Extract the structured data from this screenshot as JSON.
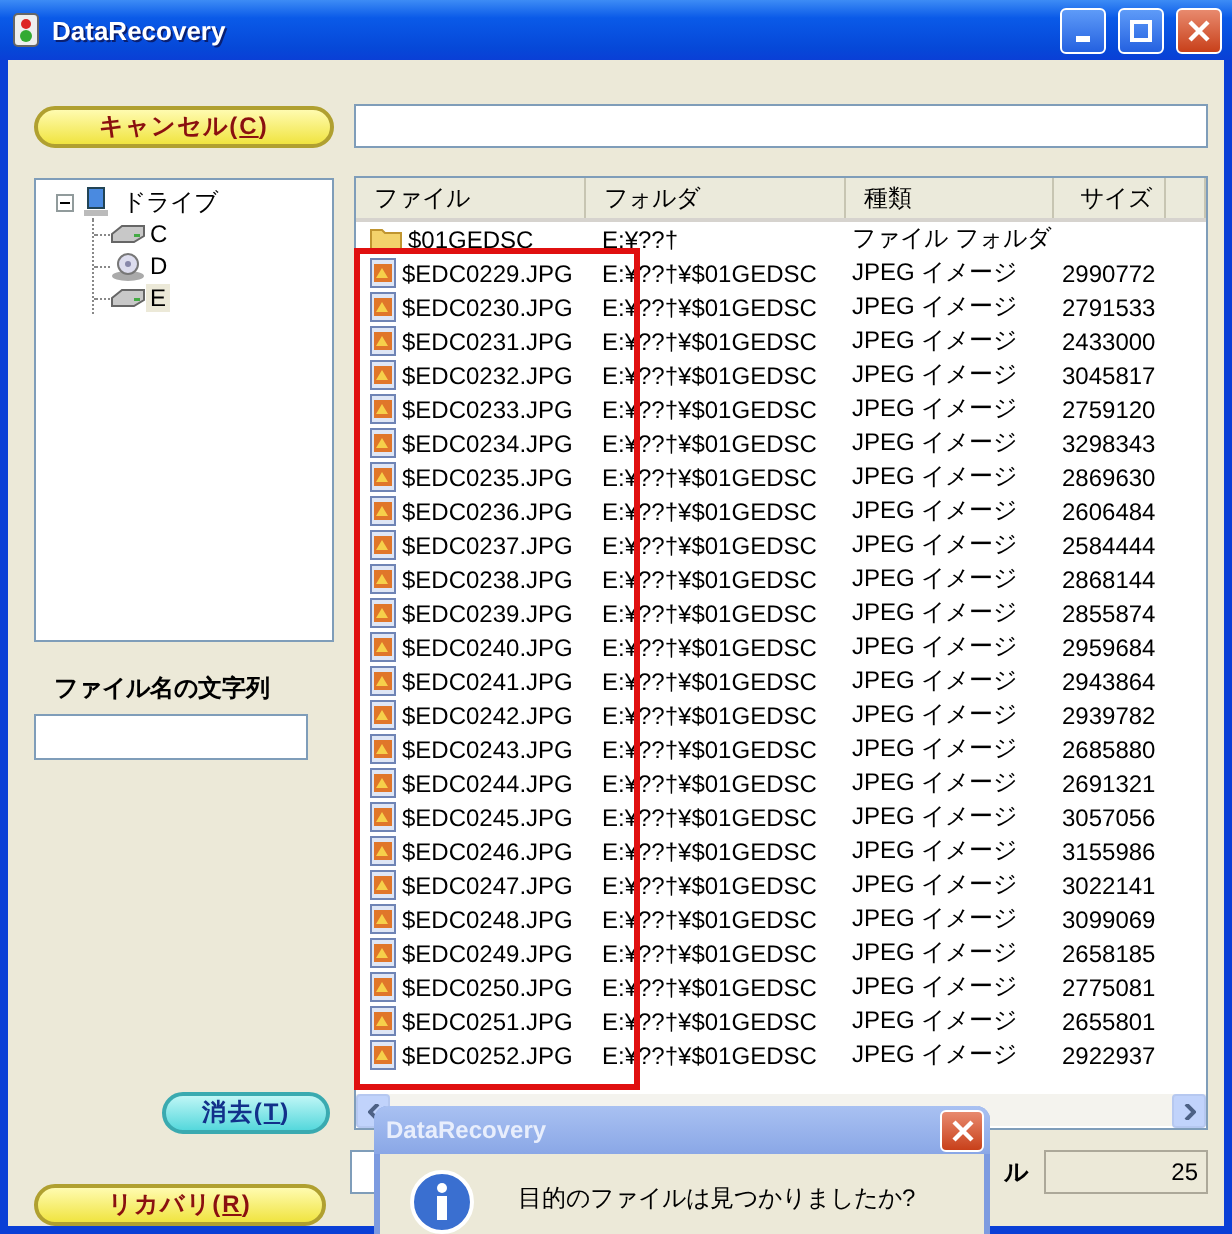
{
  "window": {
    "title": "DataRecovery"
  },
  "cancel_button": {
    "label_before": "キャンセル(",
    "mnemonic": "C",
    "label_after": ")"
  },
  "tree": {
    "label": "ドライブ",
    "expanded": true,
    "children": [
      {
        "label": "C",
        "kind": "hdd",
        "selected": false
      },
      {
        "label": "D",
        "kind": "cd",
        "selected": false
      },
      {
        "label": "E",
        "kind": "hdd",
        "selected": true
      }
    ]
  },
  "filename_filter": {
    "label": "ファイル名の文字列"
  },
  "clear_button": {
    "label_before": "消去(",
    "mnemonic": "T",
    "label_after": ")"
  },
  "recover_button": {
    "label_before": "リカバリ(",
    "mnemonic": "R",
    "label_after": ")"
  },
  "table": {
    "columns": [
      "ファイル",
      "フォルダ",
      "種類",
      "サイズ"
    ],
    "rows": [
      {
        "kind": "folder",
        "file": "$01GEDSC",
        "folder": "E:¥??†",
        "type": "ファイル フォルダ"
      },
      {
        "kind": "jpeg",
        "file": "$EDC0229.JPG",
        "folder": "E:¥??†¥$01GEDSC",
        "type": "JPEG イメージ",
        "size": "2990772"
      },
      {
        "kind": "jpeg",
        "file": "$EDC0230.JPG",
        "folder": "E:¥??†¥$01GEDSC",
        "type": "JPEG イメージ",
        "size": "2791533"
      },
      {
        "kind": "jpeg",
        "file": "$EDC0231.JPG",
        "folder": "E:¥??†¥$01GEDSC",
        "type": "JPEG イメージ",
        "size": "2433000"
      },
      {
        "kind": "jpeg",
        "file": "$EDC0232.JPG",
        "folder": "E:¥??†¥$01GEDSC",
        "type": "JPEG イメージ",
        "size": "3045817"
      },
      {
        "kind": "jpeg",
        "file": "$EDC0233.JPG",
        "folder": "E:¥??†¥$01GEDSC",
        "type": "JPEG イメージ",
        "size": "2759120"
      },
      {
        "kind": "jpeg",
        "file": "$EDC0234.JPG",
        "folder": "E:¥??†¥$01GEDSC",
        "type": "JPEG イメージ",
        "size": "3298343"
      },
      {
        "kind": "jpeg",
        "file": "$EDC0235.JPG",
        "folder": "E:¥??†¥$01GEDSC",
        "type": "JPEG イメージ",
        "size": "2869630"
      },
      {
        "kind": "jpeg",
        "file": "$EDC0236.JPG",
        "folder": "E:¥??†¥$01GEDSC",
        "type": "JPEG イメージ",
        "size": "2606484"
      },
      {
        "kind": "jpeg",
        "file": "$EDC0237.JPG",
        "folder": "E:¥??†¥$01GEDSC",
        "type": "JPEG イメージ",
        "size": "2584444"
      },
      {
        "kind": "jpeg",
        "file": "$EDC0238.JPG",
        "folder": "E:¥??†¥$01GEDSC",
        "type": "JPEG イメージ",
        "size": "2868144"
      },
      {
        "kind": "jpeg",
        "file": "$EDC0239.JPG",
        "folder": "E:¥??†¥$01GEDSC",
        "type": "JPEG イメージ",
        "size": "2855874"
      },
      {
        "kind": "jpeg",
        "file": "$EDC0240.JPG",
        "folder": "E:¥??†¥$01GEDSC",
        "type": "JPEG イメージ",
        "size": "2959684"
      },
      {
        "kind": "jpeg",
        "file": "$EDC0241.JPG",
        "folder": "E:¥??†¥$01GEDSC",
        "type": "JPEG イメージ",
        "size": "2943864"
      },
      {
        "kind": "jpeg",
        "file": "$EDC0242.JPG",
        "folder": "E:¥??†¥$01GEDSC",
        "type": "JPEG イメージ",
        "size": "2939782"
      },
      {
        "kind": "jpeg",
        "file": "$EDC0243.JPG",
        "folder": "E:¥??†¥$01GEDSC",
        "type": "JPEG イメージ",
        "size": "2685880"
      },
      {
        "kind": "jpeg",
        "file": "$EDC0244.JPG",
        "folder": "E:¥??†¥$01GEDSC",
        "type": "JPEG イメージ",
        "size": "2691321"
      },
      {
        "kind": "jpeg",
        "file": "$EDC0245.JPG",
        "folder": "E:¥??†¥$01GEDSC",
        "type": "JPEG イメージ",
        "size": "3057056"
      },
      {
        "kind": "jpeg",
        "file": "$EDC0246.JPG",
        "folder": "E:¥??†¥$01GEDSC",
        "type": "JPEG イメージ",
        "size": "3155986"
      },
      {
        "kind": "jpeg",
        "file": "$EDC0247.JPG",
        "folder": "E:¥??†¥$01GEDSC",
        "type": "JPEG イメージ",
        "size": "3022141"
      },
      {
        "kind": "jpeg",
        "file": "$EDC0248.JPG",
        "folder": "E:¥??†¥$01GEDSC",
        "type": "JPEG イメージ",
        "size": "3099069"
      },
      {
        "kind": "jpeg",
        "file": "$EDC0249.JPG",
        "folder": "E:¥??†¥$01GEDSC",
        "type": "JPEG イメージ",
        "size": "2658185"
      },
      {
        "kind": "jpeg",
        "file": "$EDC0250.JPG",
        "folder": "E:¥??†¥$01GEDSC",
        "type": "JPEG イメージ",
        "size": "2775081"
      },
      {
        "kind": "jpeg",
        "file": "$EDC0251.JPG",
        "folder": "E:¥??†¥$01GEDSC",
        "type": "JPEG イメージ",
        "size": "2655801"
      },
      {
        "kind": "jpeg",
        "file": "$EDC0252.JPG",
        "folder": "E:¥??†¥$01GEDSC",
        "type": "JPEG イメージ",
        "size": "2922937"
      }
    ]
  },
  "status": {
    "label": "ル",
    "count": "25"
  },
  "dialog": {
    "title": "DataRecovery",
    "message": "目的のファイルは見つかりましたか?"
  }
}
